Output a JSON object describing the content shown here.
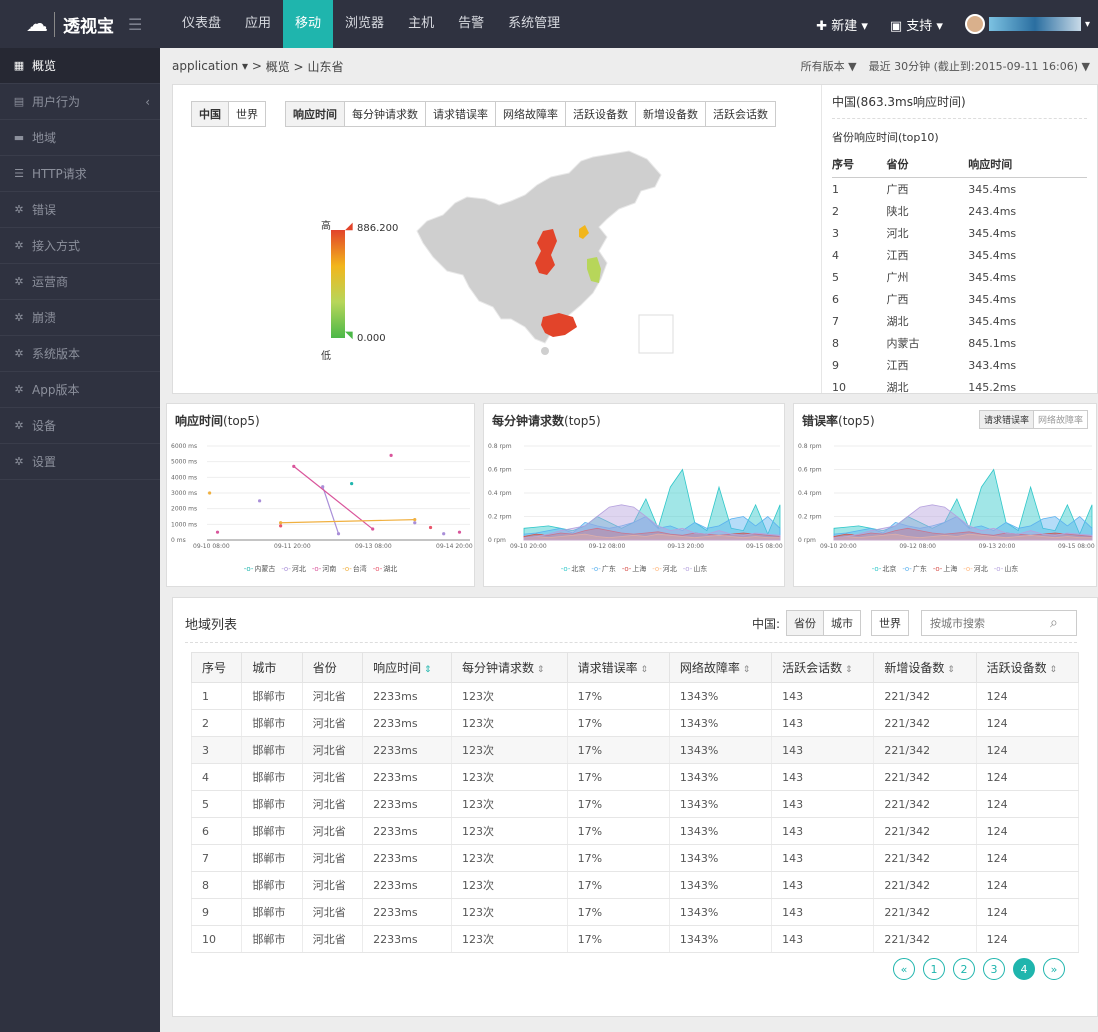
{
  "brand": {
    "logo_text": "透视宝"
  },
  "nav": [
    {
      "label": "仪表盘"
    },
    {
      "label": "应用"
    },
    {
      "label": "移动"
    },
    {
      "label": "浏览器"
    },
    {
      "label": "主机"
    },
    {
      "label": "告警"
    },
    {
      "label": "系统管理"
    }
  ],
  "nav_active": "移动",
  "topright": {
    "new": "✚ 新建 ▾",
    "support": "支持 ▾"
  },
  "sidebar": [
    {
      "label": "概览",
      "icon": "grid-icon"
    },
    {
      "label": "用户行为",
      "icon": "server-icon"
    },
    {
      "label": "地域",
      "icon": "car-icon"
    },
    {
      "label": "HTTP请求",
      "icon": "database-icon"
    },
    {
      "label": "错误",
      "icon": "gear-icon"
    },
    {
      "label": "接入方式",
      "icon": "gear-icon"
    },
    {
      "label": "运营商",
      "icon": "gear-icon"
    },
    {
      "label": "崩溃",
      "icon": "gear-icon"
    },
    {
      "label": "系统版本",
      "icon": "gear-icon"
    },
    {
      "label": "App版本",
      "icon": "gear-icon"
    },
    {
      "label": "设备",
      "icon": "gear-icon"
    },
    {
      "label": "设置",
      "icon": "gear-icon"
    }
  ],
  "breadcrumb": {
    "app": "application ▾ >",
    "overview": "概览 >",
    "province": "山东省"
  },
  "crumb_right": {
    "versions": "所有版本 ▼",
    "time": "最近 30分钟 (截止到:2015-09-11 16:06) ▼"
  },
  "map_panel": {
    "scope_tabs": [
      "中国",
      "世界"
    ],
    "metric_tabs": [
      "响应时间",
      "每分钟请求数",
      "请求错误率",
      "网络故障率",
      "活跃设备数",
      "新增设备数",
      "活跃会话数"
    ],
    "legend": {
      "high_label": "高",
      "low_label": "低",
      "max": "886.200",
      "min": "0.000"
    }
  },
  "top10": {
    "title": "中国(863.3ms响应时间)",
    "subtitle": "省份响应时间(top10)",
    "headers": [
      "序号",
      "省份",
      "响应时间"
    ],
    "rows": [
      [
        "1",
        "广西",
        "345.4ms"
      ],
      [
        "2",
        "陕北",
        "243.4ms"
      ],
      [
        "3",
        "河北",
        "345.4ms"
      ],
      [
        "4",
        "江西",
        "345.4ms"
      ],
      [
        "5",
        "广州",
        "345.4ms"
      ],
      [
        "6",
        "广西",
        "345.4ms"
      ],
      [
        "7",
        "湖北",
        "345.4ms"
      ],
      [
        "8",
        "内蒙古",
        "845.1ms"
      ],
      [
        "9",
        "江西",
        "343.4ms"
      ],
      [
        "10",
        "湖北",
        "145.2ms"
      ]
    ]
  },
  "charts_text": {
    "c1_title": "响应时间",
    "c1_suffix": "(top5)",
    "c2_title": "每分钟请求数",
    "c2_suffix": "(top5)",
    "c3_title": "错误率",
    "c3_suffix": "(top5)",
    "c3_tabs": [
      "请求错误率",
      "网络故障率"
    ]
  },
  "chart_data": [
    {
      "type": "scatter",
      "title": "响应时间(top5)",
      "ylim": [
        0,
        6000
      ],
      "yticks": [
        "0 ms",
        "1000 ms",
        "2000 ms",
        "3000 ms",
        "4000 ms",
        "5000 ms",
        "6000 ms"
      ],
      "xticks": [
        "09-10 08:00",
        "09-11 20:00",
        "09-13 08:00",
        "09-14 20:00"
      ],
      "series": [
        {
          "name": "内蒙古",
          "color": "#1fb5ad",
          "points": [
            [
              0.55,
              3600
            ]
          ]
        },
        {
          "name": "河北",
          "color": "#a98fd8",
          "points": [
            [
              0.2,
              2500
            ],
            [
              0.44,
              3400
            ],
            [
              0.5,
              400
            ],
            [
              0.79,
              1100
            ],
            [
              0.9,
              400
            ]
          ]
        },
        {
          "name": "河南",
          "color": "#d9559b",
          "points": [
            [
              0.04,
              500
            ],
            [
              0.33,
              4700
            ],
            [
              0.63,
              700
            ],
            [
              0.7,
              5400
            ],
            [
              0.96,
              500
            ]
          ]
        },
        {
          "name": "台湾",
          "color": "#f0b040",
          "points": [
            [
              0.01,
              3000
            ],
            [
              0.28,
              1100
            ],
            [
              0.79,
              1300
            ]
          ]
        },
        {
          "name": "湖北",
          "color": "#e8556b",
          "points": [
            [
              0.28,
              900
            ],
            [
              0.85,
              800
            ]
          ]
        }
      ]
    },
    {
      "type": "area",
      "title": "每分钟请求数(top5)",
      "ylim": [
        0,
        0.8
      ],
      "yticks": [
        "0 rpm",
        "0.2 rpm",
        "0.4 rpm",
        "0.6 rpm",
        "0.8 rpm"
      ],
      "xticks": [
        "09-10 20:00",
        "09-12 08:00",
        "09-13 20:00",
        "09-15 08:00"
      ],
      "series": [
        {
          "name": "北京",
          "color": "#2fc7c9",
          "values": [
            0.1,
            0.11,
            0.12,
            0.1,
            0.08,
            0.12,
            0.2,
            0.15,
            0.1,
            0.15,
            0.35,
            0.1,
            0.45,
            0.6,
            0.15,
            0.08,
            0.45,
            0.1,
            0.08,
            0.3,
            0.05,
            0.3
          ]
        },
        {
          "name": "广东",
          "color": "#5ab1ef",
          "values": [
            0.05,
            0.06,
            0.08,
            0.1,
            0.06,
            0.15,
            0.12,
            0.1,
            0.12,
            0.15,
            0.2,
            0.1,
            0.12,
            0.08,
            0.15,
            0.1,
            0.12,
            0.18,
            0.2,
            0.12,
            0.2,
            0.1
          ]
        },
        {
          "name": "上海",
          "color": "#d7504b",
          "values": [
            0.03,
            0.05,
            0.04,
            0.06,
            0.05,
            0.08,
            0.1,
            0.08,
            0.06,
            0.05,
            0.06,
            0.07,
            0.05,
            0.04,
            0.06,
            0.05,
            0.04,
            0.05,
            0.06,
            0.05,
            0.04,
            0.03
          ]
        },
        {
          "name": "河北",
          "color": "#ffb980",
          "values": [
            0.02,
            0.03,
            0.02,
            0.03,
            0.04,
            0.05,
            0.03,
            0.02,
            0.03,
            0.04,
            0.03,
            0.05,
            0.04,
            0.03,
            0.02,
            0.03,
            0.04,
            0.03,
            0.02,
            0.03,
            0.02,
            0.02
          ]
        },
        {
          "name": "山东",
          "color": "#b6a2de",
          "values": [
            0.02,
            0.03,
            0.05,
            0.08,
            0.1,
            0.12,
            0.2,
            0.28,
            0.3,
            0.28,
            0.2,
            0.12,
            0.08,
            0.1,
            0.06,
            0.05,
            0.08,
            0.05,
            0.04,
            0.06,
            0.05,
            0.04
          ]
        }
      ]
    },
    {
      "type": "area",
      "title": "错误率(top5)",
      "ylim": [
        0,
        0.8
      ],
      "yticks": [
        "0 rpm",
        "0.2 rpm",
        "0.4 rpm",
        "0.6 rpm",
        "0.8 rpm"
      ],
      "xticks": [
        "09-10 20:00",
        "09-12 08:00",
        "09-13 20:00",
        "09-15 08:00"
      ],
      "series": [
        {
          "name": "北京",
          "color": "#2fc7c9",
          "values": [
            0.1,
            0.11,
            0.12,
            0.1,
            0.08,
            0.12,
            0.2,
            0.15,
            0.1,
            0.15,
            0.35,
            0.1,
            0.45,
            0.6,
            0.15,
            0.08,
            0.45,
            0.1,
            0.08,
            0.3,
            0.05,
            0.3
          ]
        },
        {
          "name": "广东",
          "color": "#5ab1ef",
          "values": [
            0.05,
            0.06,
            0.08,
            0.1,
            0.06,
            0.15,
            0.12,
            0.1,
            0.12,
            0.15,
            0.2,
            0.1,
            0.12,
            0.08,
            0.15,
            0.1,
            0.12,
            0.18,
            0.2,
            0.12,
            0.2,
            0.1
          ]
        },
        {
          "name": "上海",
          "color": "#d7504b",
          "values": [
            0.03,
            0.05,
            0.04,
            0.06,
            0.05,
            0.08,
            0.1,
            0.08,
            0.06,
            0.05,
            0.06,
            0.07,
            0.05,
            0.04,
            0.06,
            0.05,
            0.04,
            0.05,
            0.06,
            0.05,
            0.04,
            0.03
          ]
        },
        {
          "name": "河北",
          "color": "#ffb980",
          "values": [
            0.02,
            0.03,
            0.02,
            0.03,
            0.04,
            0.05,
            0.03,
            0.02,
            0.03,
            0.04,
            0.03,
            0.05,
            0.04,
            0.03,
            0.02,
            0.03,
            0.04,
            0.03,
            0.02,
            0.03,
            0.02,
            0.02
          ]
        },
        {
          "name": "山东",
          "color": "#b6a2de",
          "values": [
            0.02,
            0.03,
            0.05,
            0.08,
            0.1,
            0.12,
            0.2,
            0.28,
            0.3,
            0.28,
            0.2,
            0.12,
            0.08,
            0.1,
            0.06,
            0.05,
            0.08,
            0.05,
            0.04,
            0.06,
            0.05,
            0.04
          ]
        }
      ]
    }
  ],
  "region": {
    "title": "地域列表",
    "china_label": "中国:",
    "prov_btn": "省份",
    "city_btn": "城市",
    "world_btn": "世界",
    "search_placeholder": "按城市搜索",
    "headers": [
      "序号",
      "城市",
      "省份",
      "响应时间",
      "每分钟请求数",
      "请求错误率",
      "网络故障率",
      "活跃会话数",
      "新增设备数",
      "活跃设备数"
    ],
    "rows": [
      [
        "1",
        "邯郸市",
        "河北省",
        "2233ms",
        "123次",
        "17%",
        "1343%",
        "143",
        "221/342",
        "124"
      ],
      [
        "2",
        "邯郸市",
        "河北省",
        "2233ms",
        "123次",
        "17%",
        "1343%",
        "143",
        "221/342",
        "124"
      ],
      [
        "3",
        "邯郸市",
        "河北省",
        "2233ms",
        "123次",
        "17%",
        "1343%",
        "143",
        "221/342",
        "124"
      ],
      [
        "4",
        "邯郸市",
        "河北省",
        "2233ms",
        "123次",
        "17%",
        "1343%",
        "143",
        "221/342",
        "124"
      ],
      [
        "5",
        "邯郸市",
        "河北省",
        "2233ms",
        "123次",
        "17%",
        "1343%",
        "143",
        "221/342",
        "124"
      ],
      [
        "6",
        "邯郸市",
        "河北省",
        "2233ms",
        "123次",
        "17%",
        "1343%",
        "143",
        "221/342",
        "124"
      ],
      [
        "7",
        "邯郸市",
        "河北省",
        "2233ms",
        "123次",
        "17%",
        "1343%",
        "143",
        "221/342",
        "124"
      ],
      [
        "8",
        "邯郸市",
        "河北省",
        "2233ms",
        "123次",
        "17%",
        "1343%",
        "143",
        "221/342",
        "124"
      ],
      [
        "9",
        "邯郸市",
        "河北省",
        "2233ms",
        "123次",
        "17%",
        "1343%",
        "143",
        "221/342",
        "124"
      ],
      [
        "10",
        "邯郸市",
        "河北省",
        "2233ms",
        "123次",
        "17%",
        "1343%",
        "143",
        "221/342",
        "124"
      ]
    ],
    "pagination": [
      "«",
      "1",
      "2",
      "3",
      "4",
      "»"
    ],
    "current_page": "4"
  },
  "colors": {
    "accent": "#1fb5ad",
    "sidebar": "#2f3240",
    "map_base": "#cfcfcf",
    "map_red": "#e2442a",
    "map_yellow": "#f2b61c",
    "map_green": "#b7d65a"
  }
}
